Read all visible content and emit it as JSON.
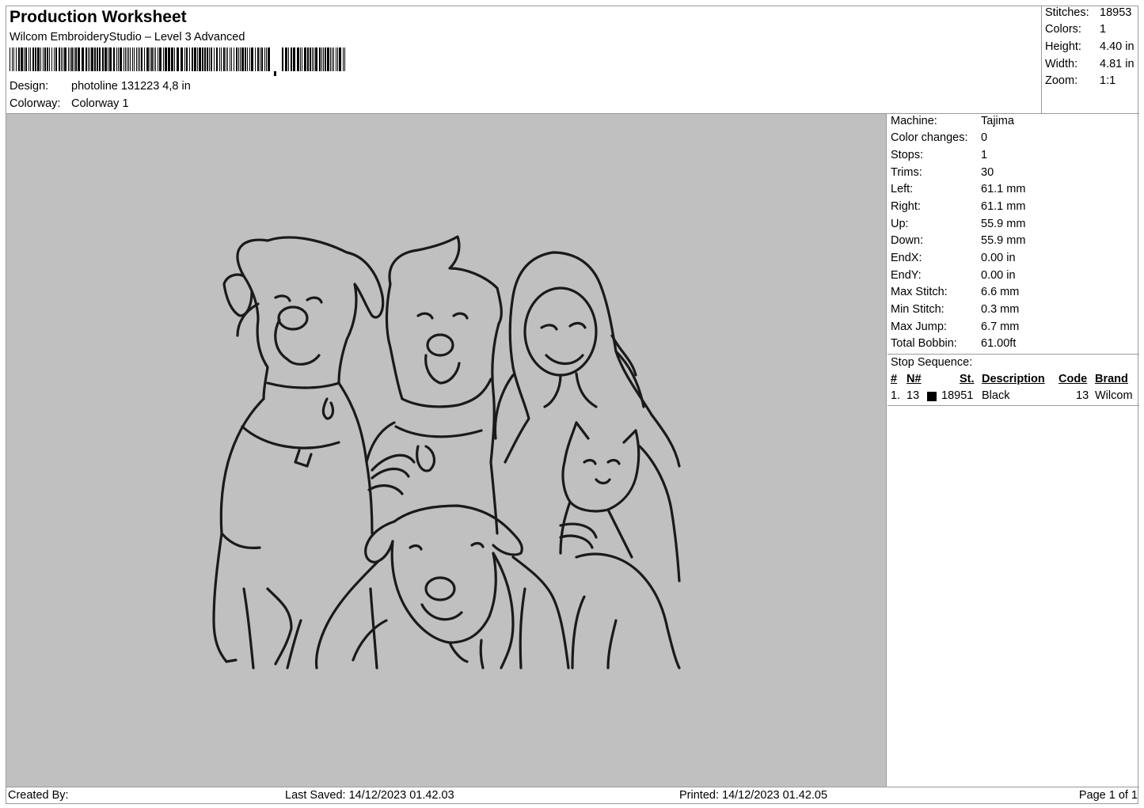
{
  "header": {
    "title": "Production Worksheet",
    "subtitle": "Wilcom EmbroideryStudio – Level 3 Advanced",
    "design_label": "Design:",
    "design_value": "photoline 131223 4,8 in",
    "colorway_label": "Colorway:",
    "colorway_value": "Colorway 1"
  },
  "stats": [
    {
      "label": "Stitches:",
      "value": "18953"
    },
    {
      "label": "Colors:",
      "value": "1"
    },
    {
      "label": "Height:",
      "value": "4.40 in"
    },
    {
      "label": "Width:",
      "value": "4.81 in"
    },
    {
      "label": "Zoom:",
      "value": "1:1"
    }
  ],
  "machine_info": [
    {
      "label": "Machine:",
      "value": "Tajima"
    },
    {
      "label": "Color changes:",
      "value": "0"
    },
    {
      "label": "Stops:",
      "value": "1"
    },
    {
      "label": "Trims:",
      "value": "30"
    },
    {
      "label": "Left:",
      "value": "61.1 mm"
    },
    {
      "label": "Right:",
      "value": "61.1 mm"
    },
    {
      "label": "Up:",
      "value": "55.9 mm"
    },
    {
      "label": "Down:",
      "value": "55.9 mm"
    },
    {
      "label": "EndX:",
      "value": "0.00 in"
    },
    {
      "label": "EndY:",
      "value": "0.00 in"
    },
    {
      "label": "Max Stitch:",
      "value": "6.6 mm"
    },
    {
      "label": "Min Stitch:",
      "value": "0.3 mm"
    },
    {
      "label": "Max Jump:",
      "value": "6.7 mm"
    },
    {
      "label": "Total Bobbin:",
      "value": "61.00ft"
    }
  ],
  "stop_sequence": {
    "title": "Stop Sequence:",
    "columns": [
      "#",
      "N#",
      "St.",
      "Description",
      "Code",
      "Brand"
    ],
    "rows": [
      {
        "index": "1.",
        "needle": "13",
        "color": "#000000",
        "stitches": "18951",
        "description": "Black",
        "code": "13",
        "brand": "Wilcom"
      }
    ]
  },
  "footer": {
    "created_by": "Created By:",
    "last_saved": "Last Saved: 14/12/2023 01.42.03",
    "printed": "Printed: 14/12/2023 01.42.05",
    "page": "Page 1 of 1"
  },
  "colors": {
    "preview_background": "#c0c0c0",
    "thread": "#1a1a1a",
    "border": "#9a9a9a"
  }
}
